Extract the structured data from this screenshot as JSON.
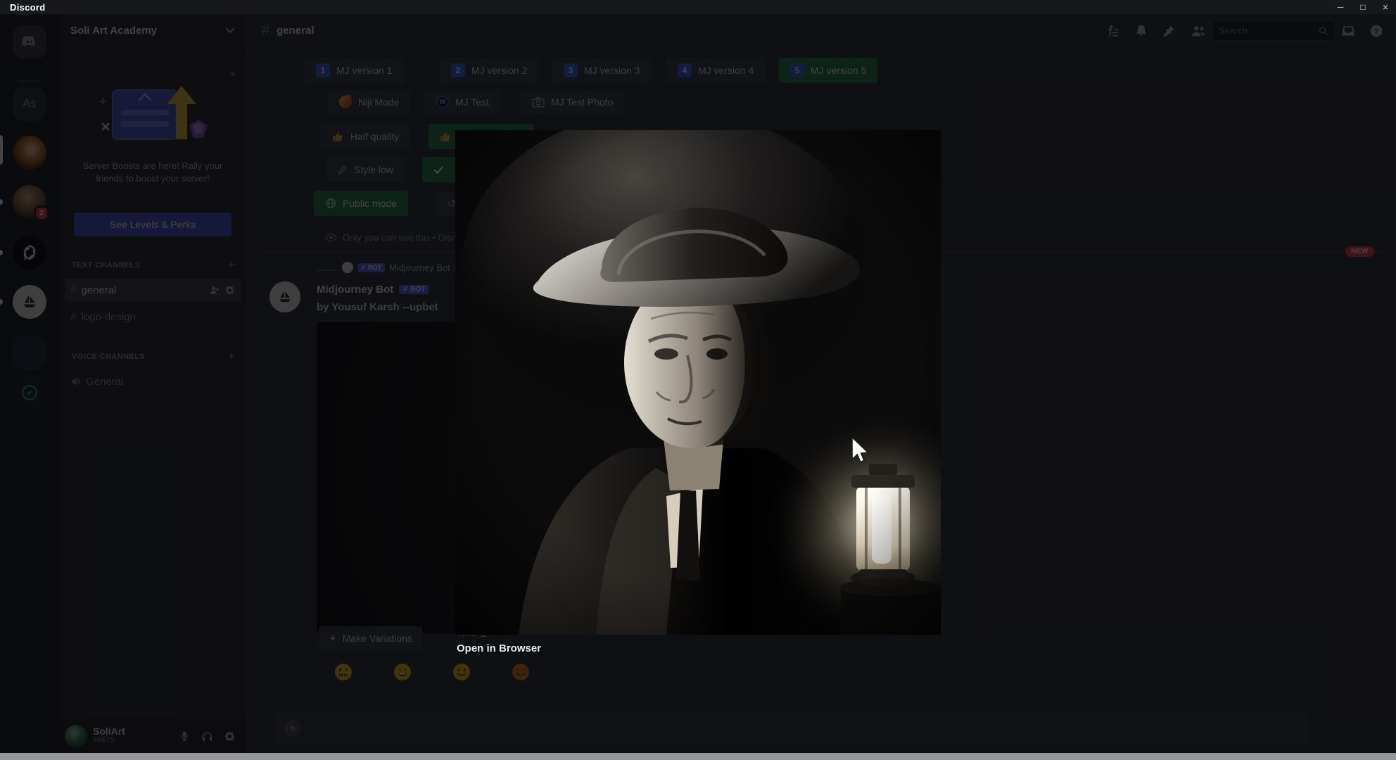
{
  "window": {
    "title": "Discord",
    "minimize": "─",
    "maximize": "□",
    "close": "×"
  },
  "rail": {
    "server_as_initials": "As",
    "painting_server_badge": "2"
  },
  "sidebar": {
    "server_name": "Soli Art Academy",
    "boost": {
      "line1": "Server Boosts are here! Rally your",
      "line2": "friends to boost your server!",
      "button_label": "See Levels & Perks"
    },
    "sections": {
      "text": "TEXT CHANNELS",
      "voice": "VOICE CHANNELS"
    },
    "channels": {
      "general": "general",
      "logo_design": "logo-design",
      "voice_general": "General"
    },
    "add_symbol": "+",
    "user": {
      "name": "SoliArt",
      "discriminator": "#6675"
    }
  },
  "toolbar": {
    "channel_name": "general",
    "search_placeholder": "Search"
  },
  "chat": {
    "new_badge": "NEW",
    "settings": {
      "row1": [
        {
          "num": "1",
          "label": "MJ version 1"
        },
        {
          "num": "2",
          "label": "MJ version 2"
        },
        {
          "num": "3",
          "label": "MJ version 3"
        },
        {
          "num": "4",
          "label": "MJ version 4"
        },
        {
          "num": "5",
          "label": "MJ version 5"
        }
      ],
      "niji": "Niji Mode",
      "mj_test": "MJ Test",
      "mj_test_photo": "MJ Test Photo",
      "half_quality": "Half quality",
      "style_low": "Style low",
      "public_mode": "Public mode"
    },
    "ephemeral_note": "Only you can see this • Dismiss message",
    "message": {
      "reply_badge": "✓ BOT",
      "reply_author": "Midjourney Bot",
      "reply_preview": "by ...",
      "author": "Midjourney Bot",
      "bot_badge": "✓ BOT",
      "text": "by Yousuf Karsh --upbet",
      "web_label": "Web",
      "variations_label": "Make Variations"
    }
  },
  "modal": {
    "open_link": "Open in Browser"
  },
  "colors": {
    "blurple": "#5865f2",
    "green_button": "#2d7d46",
    "red_badge": "#f23f43"
  }
}
